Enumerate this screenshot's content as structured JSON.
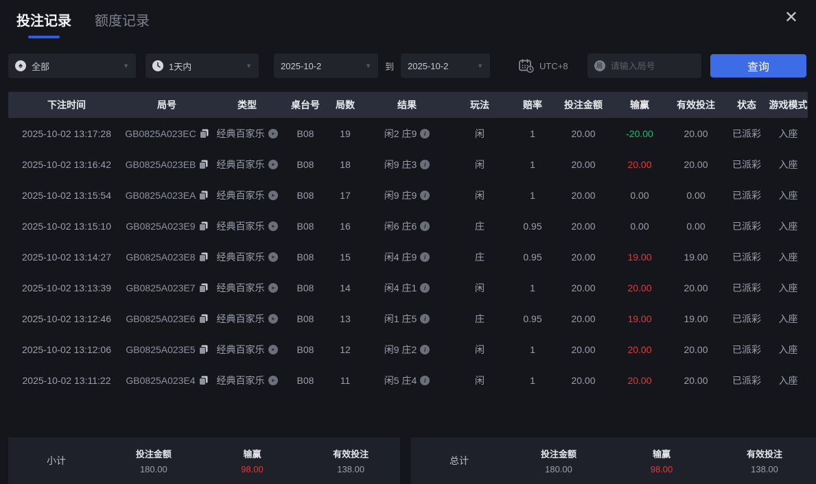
{
  "tabs": [
    {
      "label": "投注记录",
      "active": true
    },
    {
      "label": "额度记录",
      "active": false
    }
  ],
  "icons": {
    "close": "✕",
    "chevron": "▼",
    "spade": "♠",
    "bureau": "局",
    "info": "i"
  },
  "filters": {
    "game_type_value": "全部",
    "time_range_value": "1天内",
    "date_from_value": "2025-10-2",
    "to_label": "到",
    "date_to_value": "2025-10-2",
    "timezone_label": "UTC+8",
    "search_placeholder": "请输入局号",
    "query_button_label": "查询"
  },
  "colors": {
    "accent_blue": "#3d6ce6",
    "win_red": "#e03b3b",
    "win_green": "#13bf6e"
  },
  "table": {
    "headers": [
      "下注时间",
      "局号",
      "类型",
      "桌台号",
      "局数",
      "结果",
      "玩法",
      "赔率",
      "投注金额",
      "输赢",
      "有效投注",
      "状态",
      "游戏模式"
    ],
    "rows": [
      {
        "time": "2025-10-02 13:17:28",
        "game_id": "GB0825A023EC",
        "type": "经典百家乐",
        "table_no": "B08",
        "round": "19",
        "result": "闲2 庄9",
        "play": "闲",
        "odds": "1",
        "bet": "20.00",
        "win": "-20.00",
        "win_tone": "green",
        "valid": "20.00",
        "status": "已派彩",
        "mode": "入座"
      },
      {
        "time": "2025-10-02 13:16:42",
        "game_id": "GB0825A023EB",
        "type": "经典百家乐",
        "table_no": "B08",
        "round": "18",
        "result": "闲9 庄3",
        "play": "闲",
        "odds": "1",
        "bet": "20.00",
        "win": "20.00",
        "win_tone": "red",
        "valid": "20.00",
        "status": "已派彩",
        "mode": "入座"
      },
      {
        "time": "2025-10-02 13:15:54",
        "game_id": "GB0825A023EA",
        "type": "经典百家乐",
        "table_no": "B08",
        "round": "17",
        "result": "闲9 庄9",
        "play": "闲",
        "odds": "1",
        "bet": "20.00",
        "win": "0.00",
        "win_tone": "neutral",
        "valid": "0.00",
        "status": "已派彩",
        "mode": "入座"
      },
      {
        "time": "2025-10-02 13:15:10",
        "game_id": "GB0825A023E9",
        "type": "经典百家乐",
        "table_no": "B08",
        "round": "16",
        "result": "闲6 庄6",
        "play": "庄",
        "odds": "0.95",
        "bet": "20.00",
        "win": "0.00",
        "win_tone": "neutral",
        "valid": "0.00",
        "status": "已派彩",
        "mode": "入座"
      },
      {
        "time": "2025-10-02 13:14:27",
        "game_id": "GB0825A023E8",
        "type": "经典百家乐",
        "table_no": "B08",
        "round": "15",
        "result": "闲4 庄9",
        "play": "庄",
        "odds": "0.95",
        "bet": "20.00",
        "win": "19.00",
        "win_tone": "red",
        "valid": "19.00",
        "status": "已派彩",
        "mode": "入座"
      },
      {
        "time": "2025-10-02 13:13:39",
        "game_id": "GB0825A023E7",
        "type": "经典百家乐",
        "table_no": "B08",
        "round": "14",
        "result": "闲4 庄1",
        "play": "闲",
        "odds": "1",
        "bet": "20.00",
        "win": "20.00",
        "win_tone": "red",
        "valid": "20.00",
        "status": "已派彩",
        "mode": "入座"
      },
      {
        "time": "2025-10-02 13:12:46",
        "game_id": "GB0825A023E6",
        "type": "经典百家乐",
        "table_no": "B08",
        "round": "13",
        "result": "闲1 庄5",
        "play": "庄",
        "odds": "0.95",
        "bet": "20.00",
        "win": "19.00",
        "win_tone": "red",
        "valid": "19.00",
        "status": "已派彩",
        "mode": "入座"
      },
      {
        "time": "2025-10-02 13:12:06",
        "game_id": "GB0825A023E5",
        "type": "经典百家乐",
        "table_no": "B08",
        "round": "12",
        "result": "闲9 庄2",
        "play": "闲",
        "odds": "1",
        "bet": "20.00",
        "win": "20.00",
        "win_tone": "red",
        "valid": "20.00",
        "status": "已派彩",
        "mode": "入座"
      },
      {
        "time": "2025-10-02 13:11:22",
        "game_id": "GB0825A023E4",
        "type": "经典百家乐",
        "table_no": "B08",
        "round": "11",
        "result": "闲5 庄4",
        "play": "闲",
        "odds": "1",
        "bet": "20.00",
        "win": "20.00",
        "win_tone": "red",
        "valid": "20.00",
        "status": "已派彩",
        "mode": "入座"
      }
    ]
  },
  "summary": {
    "subtotal": {
      "label": "小计",
      "bet_label": "投注金额",
      "bet": "180.00",
      "win_label": "输赢",
      "win": "98.00",
      "valid_label": "有效投注",
      "valid": "138.00"
    },
    "total": {
      "label": "总计",
      "bet_label": "投注金额",
      "bet": "180.00",
      "win_label": "输赢",
      "win": "98.00",
      "valid_label": "有效投注",
      "valid": "138.00"
    }
  }
}
